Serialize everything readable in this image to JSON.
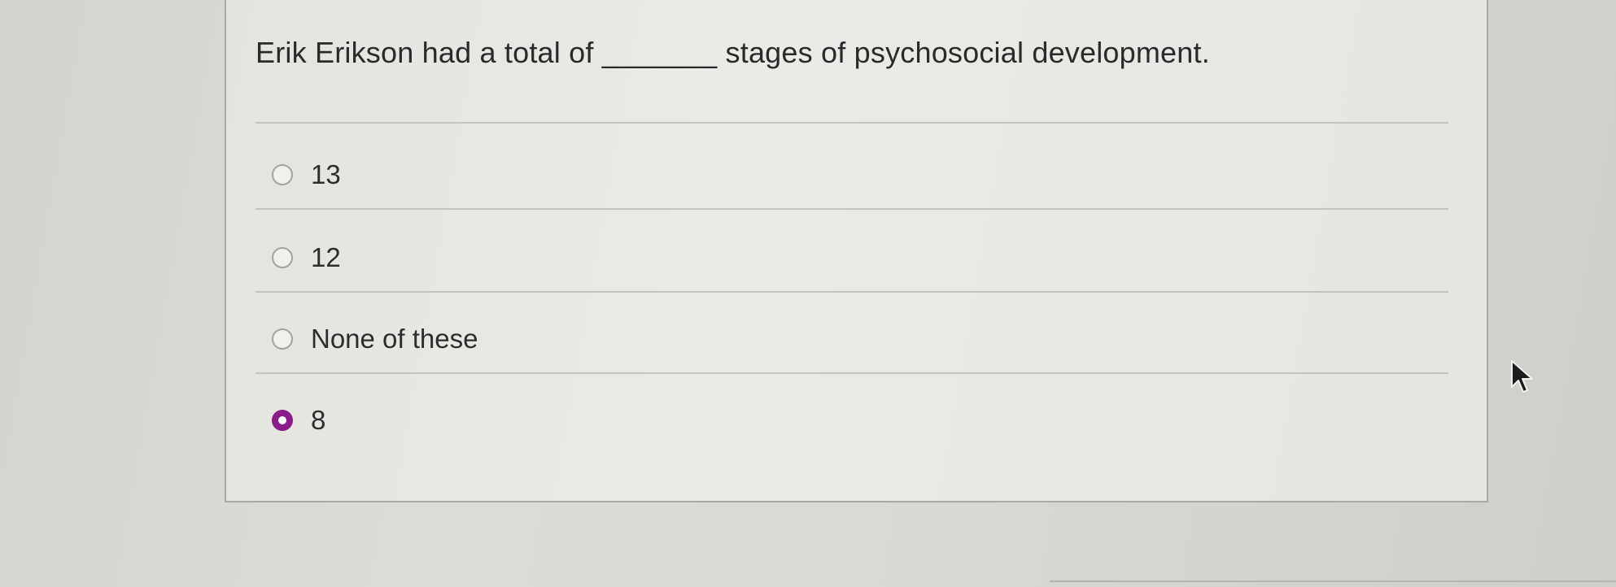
{
  "question": {
    "text": "Erik Erikson had a total of _______ stages of psychosocial development."
  },
  "options": [
    {
      "label": "13",
      "selected": false
    },
    {
      "label": "12",
      "selected": false
    },
    {
      "label": "None of these",
      "selected": false
    },
    {
      "label": "8",
      "selected": true
    }
  ],
  "colors": {
    "selected_radio": "#8a1c8c",
    "background": "#d9d9d4",
    "card": "#e8e8e3"
  },
  "icons": {
    "cursor": "mouse-pointer-icon"
  }
}
